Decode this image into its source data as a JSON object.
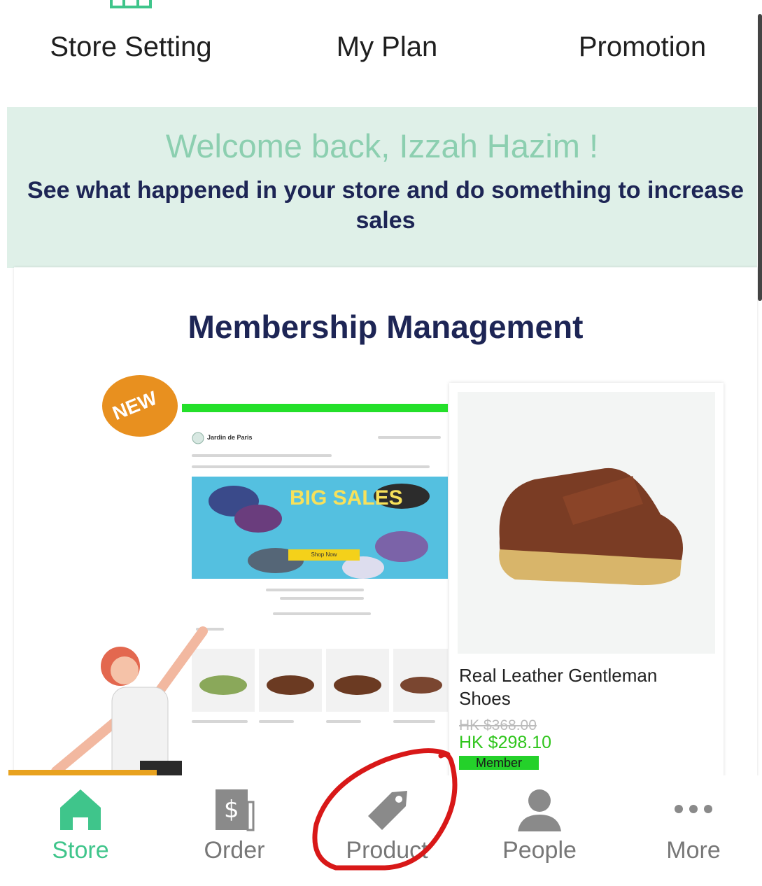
{
  "quick_actions": [
    {
      "label": "Store Setting",
      "icon": "store-icon"
    },
    {
      "label": "My Plan",
      "icon": "plan-icon"
    },
    {
      "label": "Promotion",
      "icon": "megaphone-icon"
    }
  ],
  "welcome": {
    "greeting": "Welcome back, Izzah Hazim !",
    "subtitle": "See what happened in your store and do something to increase sales"
  },
  "feature_card": {
    "title": "Membership Management",
    "badge": "NEW",
    "preview": {
      "brand": "Jardin de Paris",
      "hero_text": "BIG SALES",
      "hero_button": "Shop Now"
    },
    "product": {
      "name": "Real Leather Gentleman Shoes",
      "old_price": "HK $368.00",
      "new_price": "HK $298.10",
      "button_label": "Member"
    }
  },
  "bottom_nav": {
    "tabs": [
      {
        "label": "Store",
        "icon": "home-icon",
        "active": true
      },
      {
        "label": "Order",
        "icon": "receipt-icon",
        "active": false
      },
      {
        "label": "Product",
        "icon": "tag-icon",
        "active": false
      },
      {
        "label": "People",
        "icon": "person-icon",
        "active": false
      },
      {
        "label": "More",
        "icon": "more-icon",
        "active": false
      }
    ]
  },
  "colors": {
    "brand_green": "#3fc58b",
    "welcome_bg": "#dff0e8",
    "title_navy": "#1d2555",
    "badge_orange": "#e8901f",
    "annotation_red": "#d81818"
  }
}
